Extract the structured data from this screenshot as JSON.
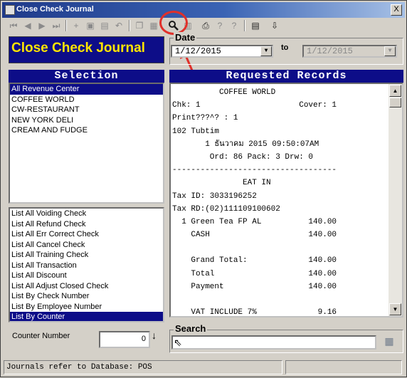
{
  "window": {
    "title": "Close Check Journal",
    "close_glyph": "X"
  },
  "toolbar": {
    "icons": [
      "first-record-icon",
      "prev-record-icon",
      "next-record-icon",
      "last-record-icon",
      "add-icon",
      "cancel-icon",
      "save-icon",
      "undo-icon",
      "copy-icon",
      "paste-icon",
      "preview-icon",
      "print-preview-icon",
      "print-icon",
      "help-query-icon",
      "help-icon",
      "export-icon",
      "exit-icon"
    ]
  },
  "banner": {
    "title": "Close Check Journal"
  },
  "date": {
    "label": "Date",
    "from": "1/12/2015",
    "to_label": "to",
    "to": "1/12/2015"
  },
  "selection": {
    "header": "Selection",
    "revenue_centers": [
      "All Revenue Center",
      "COFFEE WORLD",
      "CW-RESTAURANT",
      "NEW YORK DELI",
      "CREAM AND FUDGE"
    ],
    "selected_center": 0,
    "list_options": [
      "List All Voiding Check",
      "List All Refund Check",
      "List All Err Correct Check",
      "List All Cancel Check",
      "List All Training Check",
      "List All Transaction",
      "List All Discount",
      "List All Adjust Closed Check",
      "List By Check Number",
      "List By Employee Number",
      "List By Counter"
    ],
    "selected_option": 10
  },
  "counter": {
    "label": "Counter Number",
    "value": "0",
    "icon": "down-arrow-icon"
  },
  "records": {
    "header": "Requested Records",
    "lines": [
      "          COFFEE WORLD",
      "Chk: 1                     Cover: 1",
      "Print???^? : 1",
      "102 Tubtim",
      "       1 ธันวาคม 2015 09:50:07AM",
      "        Ord: 86 Pack: 3 Drw: 0",
      "-----------------------------------",
      "               EAT IN",
      "Tax ID: 3033196252",
      "Tax RD:(02)111109100602",
      "  1 Green Tea FP AL          140.00",
      "    CASH                     140.00",
      "",
      "    Grand Total:             140.00",
      "    Total                    140.00",
      "    Payment                  140.00",
      "",
      "    VAT INCLUDE 7%             9.16"
    ]
  },
  "search": {
    "label": "Search",
    "value": ""
  },
  "status": {
    "text": "Journals refer to Database: POS"
  },
  "accent_colors": {
    "header_bg": "#0d0d88",
    "banner_text": "#ffe400",
    "annotation": "#e0302a"
  }
}
